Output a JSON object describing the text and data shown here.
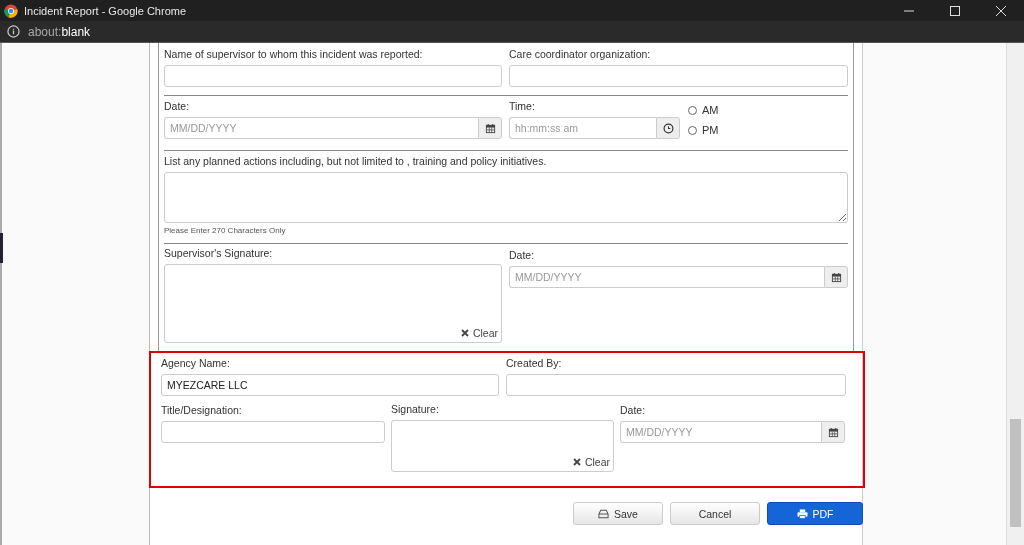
{
  "window": {
    "title": "Incident Report - Google Chrome",
    "address_scheme": "about:",
    "address_page": "blank"
  },
  "supervisor_row": {
    "supervisor_label": "Name of supervisor to whom this incident was reported:",
    "coordinator_label": "Care coordinator organization:"
  },
  "date_time_row": {
    "date_label": "Date:",
    "date_placeholder": "MM/DD/YYYY",
    "time_label": "Time:",
    "time_placeholder": "hh:mm:ss am",
    "meridiem": [
      {
        "label": "AM",
        "selected": false
      },
      {
        "label": "PM",
        "selected": false
      }
    ]
  },
  "planned_actions": {
    "label": "List any planned actions including, but not limited to , training and policy initiatives.",
    "hint": "Please Enter 270 Characters Only"
  },
  "supervisor_signature": {
    "label": "Supervisor's Signature:",
    "clear": "Clear",
    "date_label": "Date:",
    "date_placeholder": "MM/DD/YYYY"
  },
  "agency": {
    "agency_label": "Agency Name:",
    "agency_value": "MYEZCARE LLC",
    "created_label": "Created By:",
    "title_label": "Title/Designation:",
    "signature_label": "Signature:",
    "clear": "Clear",
    "date_label": "Date:",
    "date_placeholder": "MM/DD/YYYY"
  },
  "buttons": [
    {
      "label": "Save",
      "kind": "save"
    },
    {
      "label": "Cancel",
      "kind": "plain"
    },
    {
      "label": "PDF",
      "kind": "primary"
    }
  ]
}
